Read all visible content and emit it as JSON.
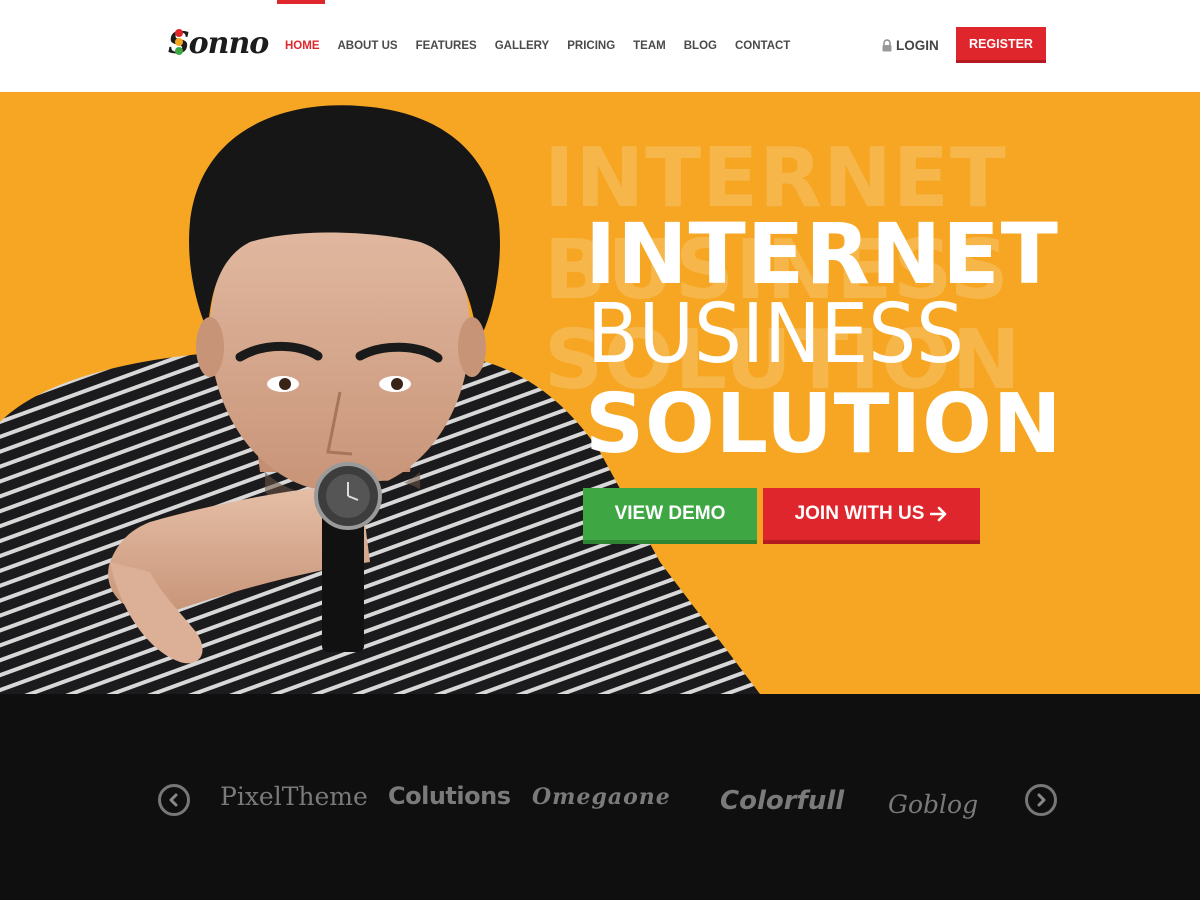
{
  "header": {
    "logo_text": "Sonno",
    "nav": [
      {
        "label": "HOME",
        "active": true
      },
      {
        "label": "ABOUT US",
        "active": false
      },
      {
        "label": "FEATURES",
        "active": false
      },
      {
        "label": "GALLERY",
        "active": false
      },
      {
        "label": "PRICING",
        "active": false
      },
      {
        "label": "TEAM",
        "active": false
      },
      {
        "label": "BLOG",
        "active": false
      },
      {
        "label": "CONTACT",
        "active": false
      }
    ],
    "login_label": "LOGIN",
    "register_label": "REGISTER"
  },
  "hero": {
    "line1": "INTERNET",
    "line2": "BUSINESS",
    "line3": "SOLUTION",
    "view_demo_label": "VIEW DEMO",
    "join_label": "JOIN WITH US",
    "icons": {
      "join": "arrow-right-icon"
    }
  },
  "partners": {
    "logos": [
      "PixelTheme",
      "Colutions",
      "Omegaone",
      "Colorfull",
      "Goblog"
    ],
    "icons": {
      "prev": "chevron-left-icon",
      "next": "chevron-right-icon"
    }
  },
  "colors": {
    "accent": "#e0262d",
    "hero_bg": "#f6a623",
    "demo_green": "#3ea743",
    "partners_bg": "#0f0f0f"
  }
}
